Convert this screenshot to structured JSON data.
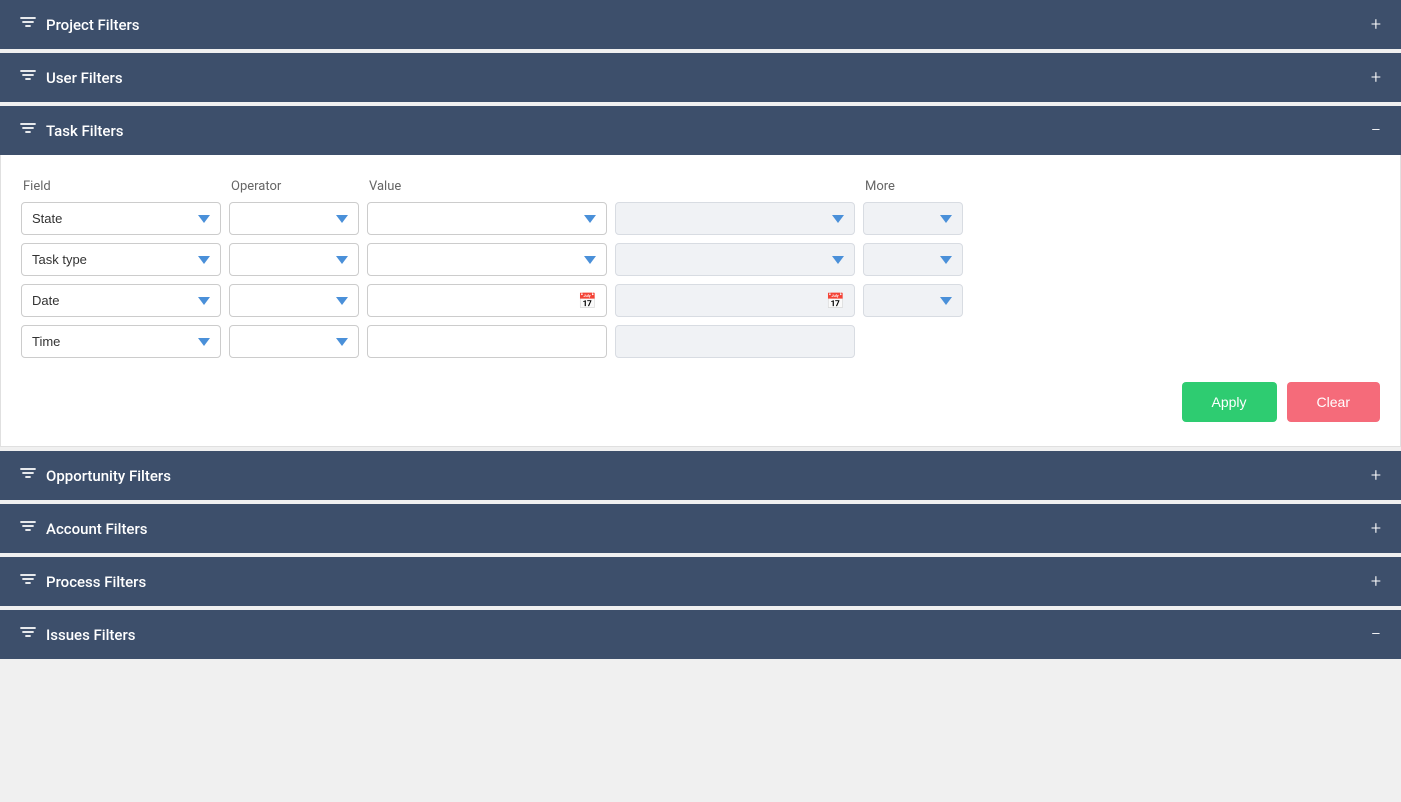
{
  "sections": {
    "project_filters": {
      "label": "Project Filters",
      "collapsed": true,
      "toggle": "+"
    },
    "user_filters": {
      "label": "User Filters",
      "collapsed": true,
      "toggle": "+"
    },
    "task_filters": {
      "label": "Task Filters",
      "collapsed": false,
      "toggle": "−"
    },
    "opportunity_filters": {
      "label": "Opportunity Filters",
      "collapsed": true,
      "toggle": "+"
    },
    "account_filters": {
      "label": "Account Filters",
      "collapsed": true,
      "toggle": "+"
    },
    "process_filters": {
      "label": "Process Filters",
      "collapsed": true,
      "toggle": "+"
    },
    "issues_filters": {
      "label": "Issues Filters",
      "collapsed": false,
      "toggle": "−"
    }
  },
  "task_filters_content": {
    "columns": {
      "field_label": "Field",
      "operator_label": "Operator",
      "value_label": "Value",
      "more_label": "More"
    },
    "rows": [
      {
        "field": "State",
        "field_options": [
          "State"
        ],
        "operator_options": [],
        "value1_options": [],
        "value2_options": [],
        "more_options": [],
        "value1_muted": false,
        "value2_muted": true,
        "more_muted": true,
        "has_calendar": false
      },
      {
        "field": "Task type",
        "field_options": [
          "Task type"
        ],
        "operator_options": [],
        "value1_options": [],
        "value2_options": [],
        "more_options": [],
        "value1_muted": false,
        "value2_muted": true,
        "more_muted": true,
        "has_calendar": false
      },
      {
        "field": "Date",
        "field_options": [
          "Date"
        ],
        "operator_options": [],
        "has_calendar": true,
        "value1_muted": false,
        "value2_muted": true,
        "more_muted": true
      },
      {
        "field": "Time",
        "field_options": [
          "Time"
        ],
        "operator_options": [],
        "has_calendar": false,
        "value1_muted": false,
        "value2_muted": true,
        "more_hidden": true
      }
    ],
    "buttons": {
      "apply": "Apply",
      "clear": "Clear"
    }
  }
}
